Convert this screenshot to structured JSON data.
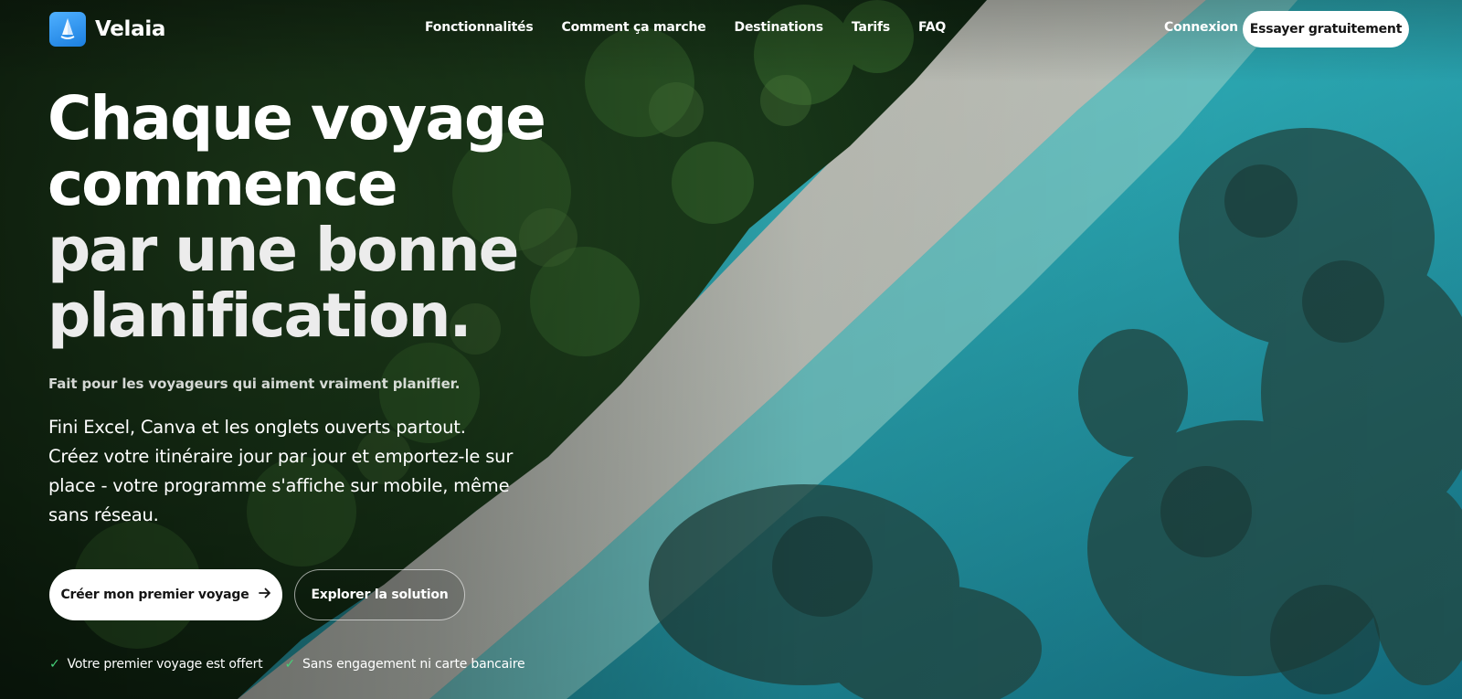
{
  "brand": {
    "name": "Velaia",
    "accent": "#2a8ff0"
  },
  "nav": {
    "links": [
      "Fonctionnalités",
      "Comment ça marche",
      "Destinations",
      "Tarifs",
      "FAQ"
    ],
    "login": "Connexion",
    "cta": "Essayer gratuitement"
  },
  "hero": {
    "headline": [
      "Chaque voyage",
      "commence",
      "par une bonne",
      "planification."
    ],
    "tagline": "Fait pour les voyageurs qui aiment vraiment planifier.",
    "description": "Fini Excel, Canva et les onglets ouverts partout. Créez votre itinéraire jour par jour et emportez-le sur place - votre programme s'affiche sur mobile, même sans réseau.",
    "primary_button": "Créer mon premier voyage",
    "primary_button_icon": "arrow-right-icon",
    "secondary_button": "Explorer la solution",
    "perks": [
      {
        "icon": "check-icon",
        "text": "Votre premier voyage est offert"
      },
      {
        "icon": "check-icon",
        "text": "Sans engagement ni carte bancaire"
      }
    ],
    "perk_color": "#46d27a"
  }
}
